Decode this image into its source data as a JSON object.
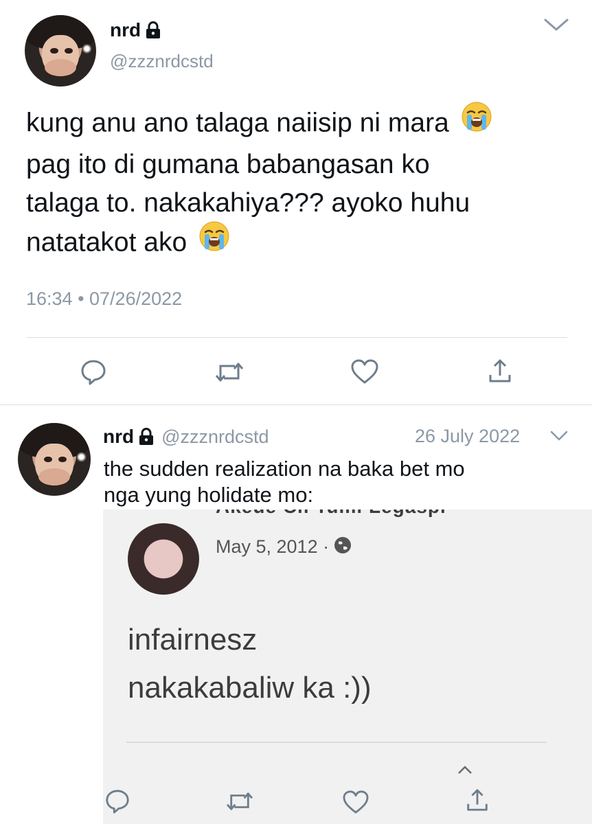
{
  "main_tweet": {
    "name": "nrd",
    "handle": "@zzznrdcstd",
    "text_lines": [
      "kung anu ano talaga naiisip ni mara",
      "pag ito di gumana babangasan ko",
      "talaga to. nakakahiya??? ayoko huhu",
      "natatakot ako"
    ],
    "timestamp": "16:34 • 07/26/2022",
    "icons": {
      "menu": "chevron-down-icon",
      "lock": "lock-icon",
      "emoji": "loudly-crying-face-emoji",
      "reply": "reply-icon",
      "retweet": "retweet-icon",
      "like": "heart-icon",
      "share": "share-icon"
    }
  },
  "quoted_tweet": {
    "name": "nrd",
    "handle": "@zzznrdcstd",
    "date": "26 July 2022",
    "text_lines": [
      "the sudden realization na baka bet mo",
      "nga yung holidate mo:"
    ]
  },
  "embedded_image": {
    "cut_off_name": "Akeue Cil Tumi Legaspi",
    "post_date": "May 5, 2012 ·",
    "post_text_lines": [
      "infairnesz",
      "nakakabaliw ka :))"
    ],
    "globe_icon": "globe-icon"
  },
  "colors": {
    "text": "#0f1419",
    "secondary": "#8b98a5",
    "icon": "#6e7d8b",
    "divider": "#d9dde1",
    "screenshot_bg": "#f1f1f1",
    "screenshot_text": "#3c3c3c"
  }
}
